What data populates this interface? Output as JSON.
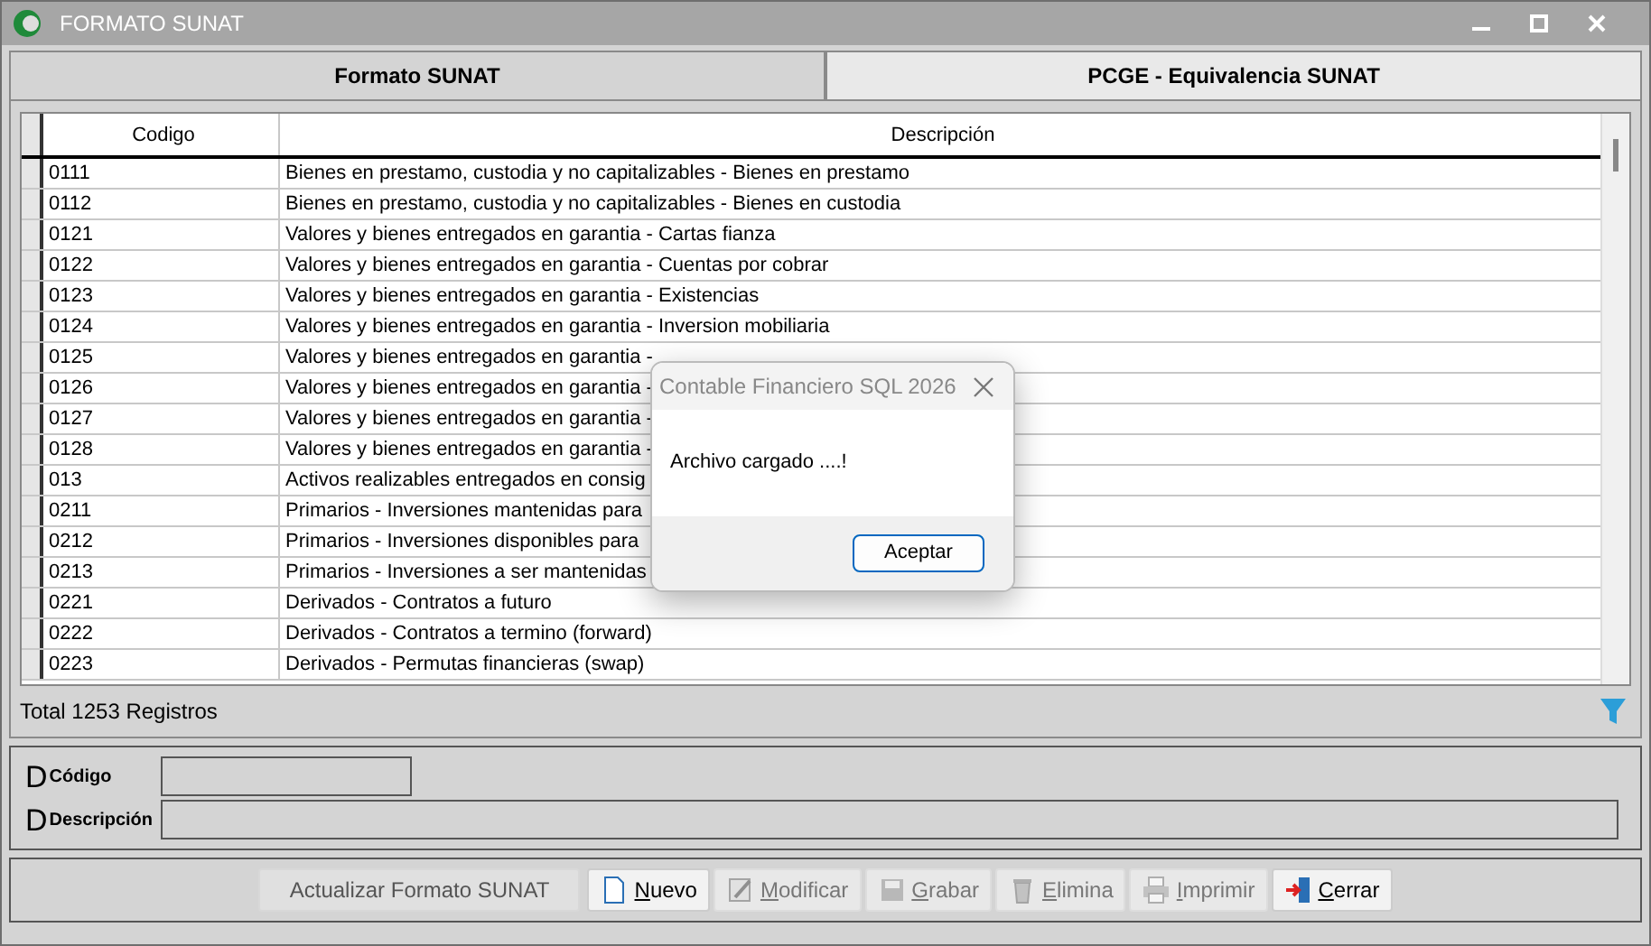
{
  "window": {
    "title": "FORMATO SUNAT"
  },
  "tabs": [
    {
      "label": "Formato SUNAT",
      "selected": true
    },
    {
      "label": "PCGE - Equivalencia SUNAT",
      "selected": false
    }
  ],
  "table": {
    "columns": [
      "Codigo",
      "Descripción"
    ],
    "rows": [
      [
        "0111",
        "Bienes en prestamo, custodia y no capitalizables - Bienes en prestamo"
      ],
      [
        "0112",
        "Bienes en prestamo, custodia y no capitalizables - Bienes en custodia"
      ],
      [
        "0121",
        "Valores y bienes entregados en garantia - Cartas fianza"
      ],
      [
        "0122",
        "Valores y bienes entregados en garantia - Cuentas por cobrar"
      ],
      [
        "0123",
        "Valores y bienes entregados en garantia - Existencias"
      ],
      [
        "0124",
        "Valores y bienes entregados en garantia - Inversion mobiliaria"
      ],
      [
        "0125",
        "Valores y bienes entregados en garantia -"
      ],
      [
        "0126",
        "Valores y bienes entregados en garantia -"
      ],
      [
        "0127",
        "Valores y bienes entregados en garantia -"
      ],
      [
        "0128",
        "Valores y bienes entregados en garantia -"
      ],
      [
        "013",
        "Activos realizables entregados en consig"
      ],
      [
        "0211",
        "Primarios - Inversiones mantenidas para"
      ],
      [
        "0212",
        "Primarios - Inversiones disponibles para"
      ],
      [
        "0213",
        "Primarios - Inversiones a ser mantenidas"
      ],
      [
        "0221",
        "Derivados - Contratos a futuro"
      ],
      [
        "0222",
        "Derivados - Contratos a termino (forward)"
      ],
      [
        "0223",
        "Derivados - Permutas financieras (swap)"
      ]
    ]
  },
  "total": "Total 1253 Registros",
  "fields": [
    {
      "mark": "D",
      "label": "Código",
      "kind": "short"
    },
    {
      "mark": "D",
      "label": "Descripción",
      "kind": "wide"
    }
  ],
  "buttons": [
    {
      "label": "Actualizar Formato SUNAT",
      "kind": "flat",
      "disabled": true
    },
    {
      "label": "Nuevo",
      "kind": "new",
      "disabled": false
    },
    {
      "label": "Modificar",
      "kind": "edit",
      "disabled": true
    },
    {
      "label": "Grabar",
      "kind": "save",
      "disabled": true
    },
    {
      "label": "Elimina",
      "kind": "delete",
      "disabled": true
    },
    {
      "label": "Imprimir",
      "kind": "print",
      "disabled": true
    },
    {
      "label": "Cerrar",
      "kind": "close",
      "disabled": false
    }
  ],
  "dialog": {
    "title": "Contable Financiero SQL 2026",
    "message": "Archivo cargado ....!",
    "button": "Aceptar"
  }
}
